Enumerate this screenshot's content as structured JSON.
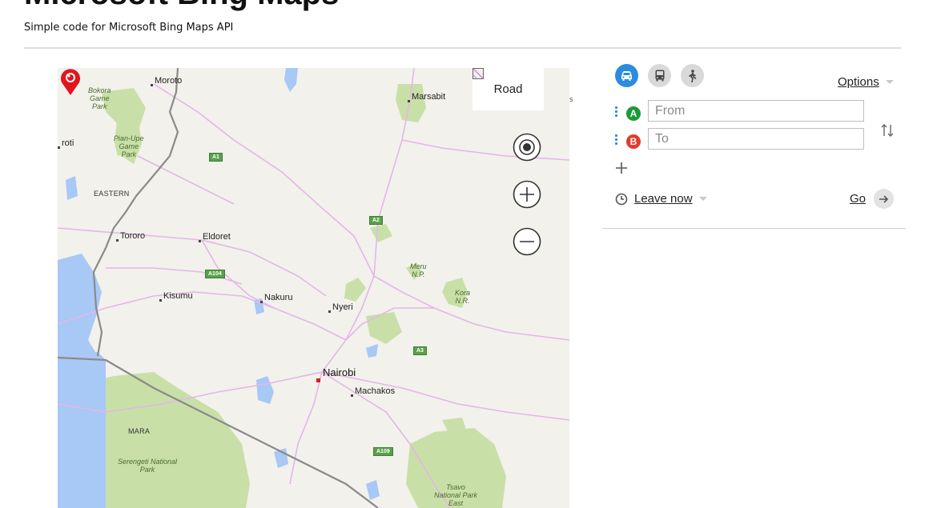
{
  "header": {
    "title": "Microsoft Bing Maps",
    "subtitle": "Simple code for Microsoft Bing Maps API"
  },
  "map": {
    "map_type_label": "Road",
    "towns": [
      "Moroto",
      "Marsabit",
      "Tororo",
      "Eldoret",
      "Kisumu",
      "Nakuru",
      "Nyeri",
      "Machakos"
    ],
    "capital": "Nairobi",
    "regions": [
      "EASTERN",
      "MARA"
    ],
    "parks": {
      "bokora": "Bokora Game Park",
      "pian_upe": "Pian-Upe Game Park",
      "meru": "Meru N.P.",
      "kora": "Kora N.R.",
      "serengeti": "Serengeti National Park",
      "tsavo": "Tsavo National Park East"
    },
    "park_lines": {
      "bokora": [
        "Bokora",
        "Game",
        "Park"
      ],
      "pian_upe": [
        "Pian-Upe",
        "Game",
        "Park"
      ],
      "meru": [
        "Meru",
        "N.P."
      ],
      "kora": [
        "Kora",
        "N.R."
      ],
      "serengeti": [
        "Serengeti National",
        "Park"
      ],
      "tsavo": [
        "Tsavo",
        "National Park",
        "East"
      ]
    },
    "roads": [
      "A1",
      "A2",
      "A104",
      "A3",
      "A109"
    ],
    "partial_labels": {
      "left_edge": "roti",
      "right_edge": "s"
    },
    "colors": {
      "land": "#f2f1ec",
      "water": "#a8c8f5",
      "park": "#c9dfa8",
      "road": "#e4b6e8",
      "border": "#8a8a8a",
      "pushpin": "#e0161b"
    }
  },
  "directions": {
    "modes": [
      {
        "name": "driving",
        "icon": "car-icon",
        "active": true
      },
      {
        "name": "transit",
        "icon": "bus-icon",
        "active": false
      },
      {
        "name": "walking",
        "icon": "walk-icon",
        "active": false
      }
    ],
    "options_label": "Options",
    "from": {
      "badge": "A",
      "placeholder": "From",
      "value": "",
      "color": "#1a9a3a"
    },
    "to": {
      "badge": "B",
      "placeholder": "To",
      "value": "",
      "color": "#e23b2e"
    },
    "leave_now_label": "Leave now",
    "go_label": "Go",
    "accent": "#2b8be0"
  }
}
